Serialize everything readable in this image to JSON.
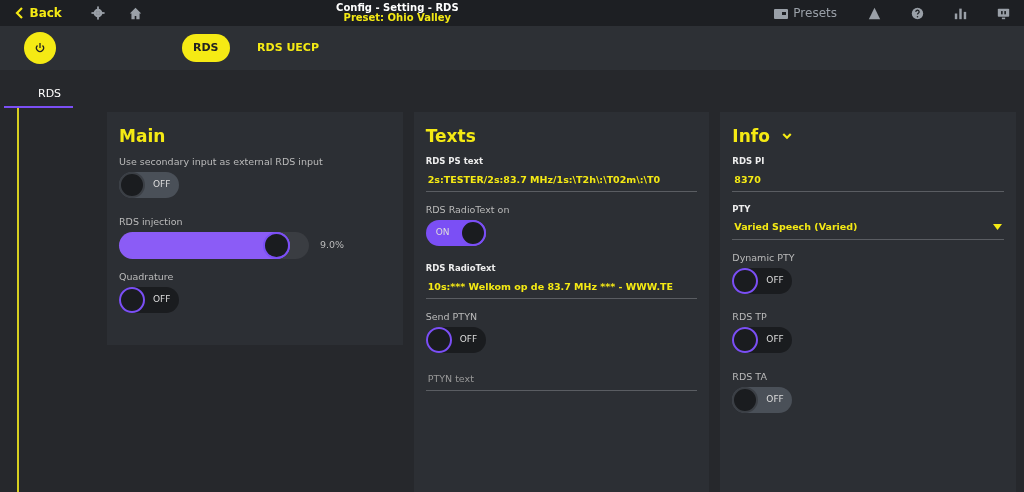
{
  "topbar": {
    "back": "Back",
    "title": "Config - Setting - RDS",
    "subtitle": "Preset: Ohio Valley",
    "presets": "Presets"
  },
  "power": {
    "on": true
  },
  "mode_tabs": [
    {
      "label": "RDS",
      "selected": true
    },
    {
      "label": "RDS UECP",
      "selected": false
    }
  ],
  "section_tabs": [
    {
      "label": "RDS",
      "selected": true
    }
  ],
  "cards": [
    {
      "title": "Main",
      "collapsible": false,
      "items": [
        {
          "kind": "toggle",
          "label": "Use secondary input as external RDS input",
          "on": false,
          "disabled": true,
          "state_text": "OFF"
        },
        {
          "kind": "slider",
          "label": "RDS injection",
          "level": 0.9,
          "reading": "9.0%"
        },
        {
          "kind": "toggle",
          "label": "Quadrature",
          "on": false,
          "disabled": false,
          "state_text": "OFF"
        }
      ]
    },
    {
      "title": "Texts",
      "collapsible": false,
      "items": [
        {
          "kind": "field",
          "label": "RDS PS text",
          "value": "2s:TESTER/2s:83.7 MHz/1s:\\T2h\\:\\T02m\\:\\T0"
        },
        {
          "kind": "toggle",
          "label": "RDS RadioText on",
          "on": true,
          "disabled": false,
          "state_text": "ON"
        },
        {
          "kind": "field",
          "label": "RDS RadioText",
          "value": "10s:*** Welkom op de 83.7 MHz *** - WWW.TE"
        },
        {
          "kind": "toggle",
          "label": "Send PTYN",
          "on": false,
          "disabled": false,
          "state_text": "OFF"
        },
        {
          "kind": "field",
          "placeholder": "PTYN text"
        }
      ]
    },
    {
      "title": "Info",
      "collapsible": true,
      "items": [
        {
          "kind": "field",
          "label": "RDS PI",
          "value": "8370"
        },
        {
          "kind": "select",
          "label": "PTY",
          "value": "Varied Speech (Varied)"
        },
        {
          "kind": "toggle",
          "label": "Dynamic PTY",
          "on": false,
          "disabled": false,
          "state_text": "OFF"
        },
        {
          "kind": "toggle",
          "label": "RDS TP",
          "on": false,
          "disabled": false,
          "state_text": "OFF"
        },
        {
          "kind": "toggle",
          "label": "RDS TA",
          "on": false,
          "disabled": true,
          "state_text": "OFF"
        }
      ]
    }
  ]
}
